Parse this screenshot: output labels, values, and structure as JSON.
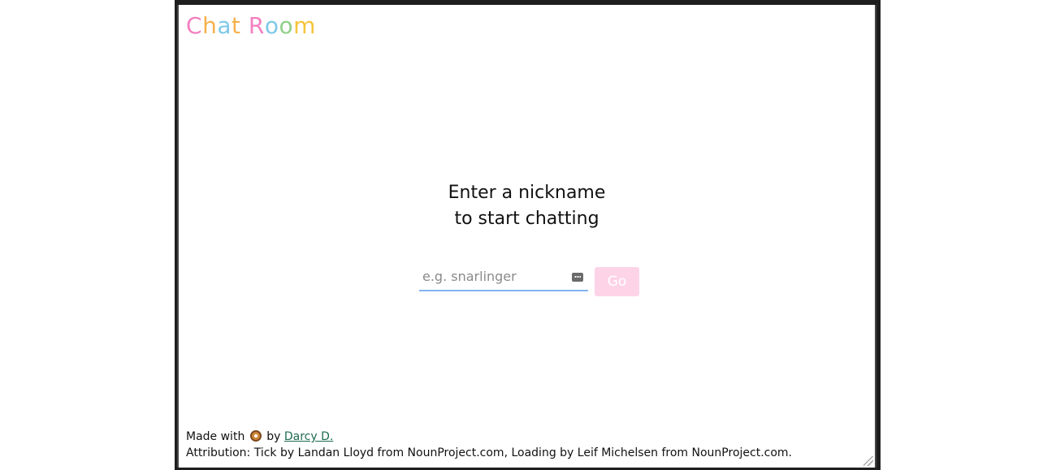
{
  "app": {
    "brand_letters": [
      {
        "ch": "C",
        "color": "#f27fc0"
      },
      {
        "ch": "h",
        "color": "#f5b14c"
      },
      {
        "ch": "a",
        "color": "#7ec8e8"
      },
      {
        "ch": "t",
        "color": "#f5b14c"
      },
      {
        "ch": " ",
        "color": "#ffffff"
      },
      {
        "ch": "R",
        "color": "#f27fc0"
      },
      {
        "ch": "o",
        "color": "#7ec8e8"
      },
      {
        "ch": "o",
        "color": "#8fd18a"
      },
      {
        "ch": "m",
        "color": "#f5c43a"
      }
    ]
  },
  "prompt": {
    "line1": "Enter a nickname",
    "line2": "to start chatting"
  },
  "form": {
    "nickname_value": "",
    "nickname_placeholder": "e.g. snarlinger",
    "go_label": "Go",
    "go_color": "#fdd3e8",
    "input_underline_color": "#80b4f0"
  },
  "footer": {
    "made_with": "Made with",
    "by": "by",
    "author_link": "Darcy D.",
    "attribution": "Attribution: Tick by Landan Lloyd from NounProject.com, Loading by Leif Michelsen from NounProject.com."
  },
  "icons": {
    "donut": "donut-icon",
    "password_manager": "keyboard-dots-icon"
  }
}
